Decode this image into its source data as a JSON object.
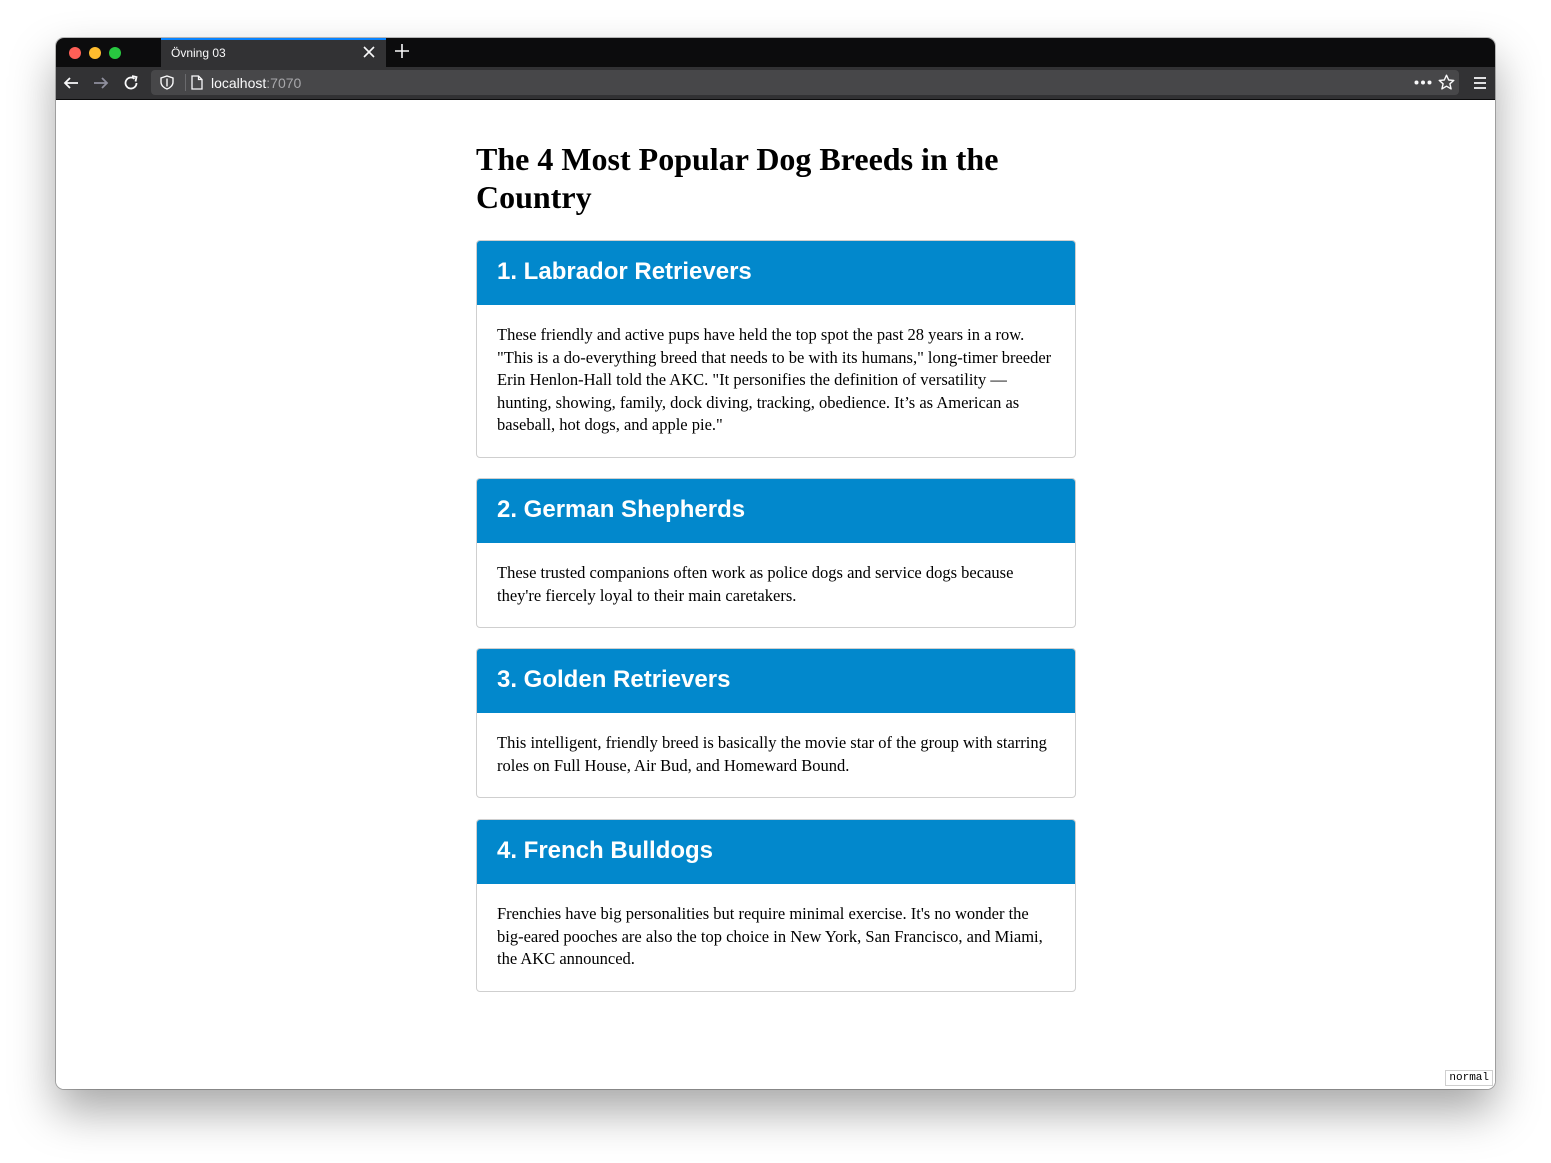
{
  "browser": {
    "tab_title": "Övning 03",
    "url_host": "localhost",
    "url_port": ":7070",
    "accent": "#0a84ff"
  },
  "page": {
    "title": "The 4 Most Popular Dog Breeds in the Country",
    "cards": [
      {
        "title": "1. Labrador Retrievers",
        "body": "These friendly and active pups have held the top spot the past 28 years in a row. \"This is a do-everything breed that needs to be with its humans,\" long-timer breeder Erin Henlon-Hall told the AKC. \"It personifies the definition of versatility — hunting, showing, family, dock diving, tracking, obedience. It’s as American as baseball, hot dogs, and apple pie.\""
      },
      {
        "title": "2. German Shepherds",
        "body": "These trusted companions often work as police dogs and service dogs because they're fiercely loyal to their main caretakers."
      },
      {
        "title": "3. Golden Retrievers",
        "body": "This intelligent, friendly breed is basically the movie star of the group with starring roles on Full House, Air Bud, and Homeward Bound."
      },
      {
        "title": "4. French Bulldogs",
        "body": "Frenchies have big personalities but require minimal exercise. It's no wonder the big-eared pooches are also the top choice in New York, San Francisco, and Miami, the AKC announced."
      }
    ],
    "card_header_color": "#0288cc"
  },
  "corner_badge": "normal"
}
